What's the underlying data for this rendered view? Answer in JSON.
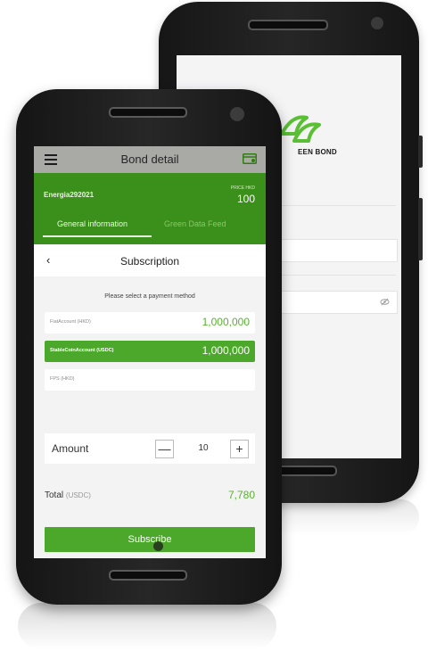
{
  "back_screen": {
    "logo_text": "EEN BOND",
    "field_icon": "eye-off-icon"
  },
  "appbar": {
    "title": "Bond detail",
    "menu_icon": "hamburger-menu-icon",
    "action_icon": "card-settings-icon"
  },
  "bond": {
    "name": "Energia292021",
    "price_label": "PRICE HKD",
    "price_value": "100"
  },
  "tabs": [
    {
      "label": "General information",
      "active": true
    },
    {
      "label": "Green Data Feed",
      "active": false
    }
  ],
  "subscription": {
    "title": "Subscription",
    "payment_prompt": "Please select a payment method",
    "payment_methods": [
      {
        "label": "FiatAccount (HKD)",
        "value": "1,000,000",
        "selected": false
      },
      {
        "label": "StableCoinAccount (USDC)",
        "value": "1,000,000",
        "selected": true
      },
      {
        "label": "FPS (HKD)",
        "value": "",
        "selected": false
      }
    ],
    "amount_label": "Amount",
    "amount_value": "10",
    "minus_symbol": "—",
    "plus_symbol": "+",
    "total_label": "Total",
    "total_unit": "(USDC)",
    "total_value": "7,780",
    "subscribe_label": "Subscribe"
  },
  "colors": {
    "brand_green": "#3b8f1b",
    "accent_green": "#4ca82a",
    "value_green": "#5ab032",
    "appbar_gray": "#a9aaa6"
  }
}
